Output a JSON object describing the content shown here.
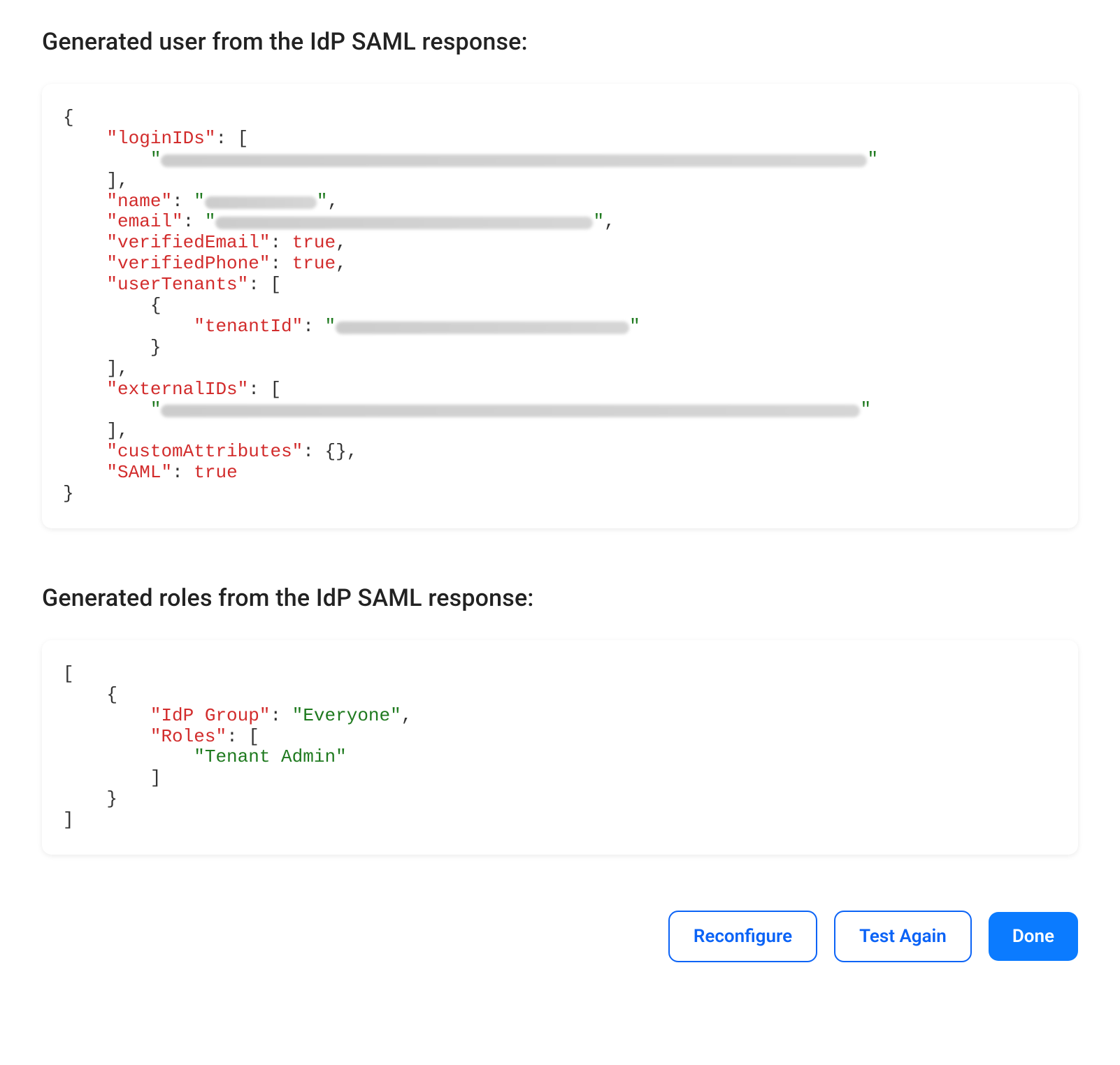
{
  "sections": {
    "user": {
      "title": "Generated user from the IdP SAML response:",
      "json": {
        "keys": {
          "loginIDs": "loginIDs",
          "name": "name",
          "email": "email",
          "verifiedEmail": "verifiedEmail",
          "verifiedPhone": "verifiedPhone",
          "userTenants": "userTenants",
          "tenantId": "tenantId",
          "externalIDs": "externalIDs",
          "customAttributes": "customAttributes",
          "SAML": "SAML"
        },
        "values": {
          "verifiedEmail": "true",
          "verifiedPhone": "true",
          "customAttributes": "{}",
          "SAML": "true"
        }
      }
    },
    "roles": {
      "title": "Generated roles from the IdP SAML response:",
      "json": {
        "keys": {
          "idpGroup": "IdP Group",
          "roles": "Roles"
        },
        "values": {
          "idpGroup": "Everyone",
          "role0": "Tenant Admin"
        }
      }
    }
  },
  "buttons": {
    "reconfigure": "Reconfigure",
    "testAgain": "Test Again",
    "done": "Done"
  }
}
